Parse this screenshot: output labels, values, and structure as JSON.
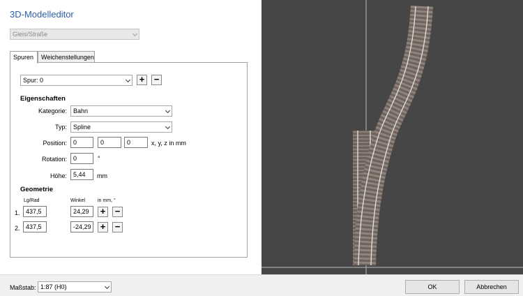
{
  "app_title": "3D-Modelleditor",
  "type_select": {
    "value": "Gleis/Straße"
  },
  "tabs": [
    {
      "label": "Spuren",
      "active": true
    },
    {
      "label": "Weichenstellungen",
      "active": false
    }
  ],
  "track_select": {
    "value": "Spur: 0"
  },
  "properties": {
    "heading": "Eigenschaften",
    "kategorie_label": "Kategorie:",
    "kategorie_value": "Bahn",
    "typ_label": "Typ:",
    "typ_value": "Spline",
    "position_label": "Position:",
    "position_x": "0",
    "position_y": "0",
    "position_z": "0",
    "position_unit": "x, y, z in mm",
    "rotation_label": "Rotation:",
    "rotation_value": "0",
    "rotation_unit": "°",
    "height_label": "Höhe:",
    "height_value": "5,44",
    "height_unit": "mm"
  },
  "geometry": {
    "heading": "Geometrie",
    "col_length": "Lg/Rad",
    "col_angle": "Winkel",
    "col_units": "in mm, °",
    "rows": [
      {
        "index": "1.",
        "length": "437,5",
        "angle": "24,29"
      },
      {
        "index": "2.",
        "length": "437,5",
        "angle": "-24,29"
      }
    ]
  },
  "icons": {
    "add": "+",
    "remove": "−"
  },
  "footer": {
    "scale_label": "Maßstab:",
    "scale_value": "1:87 (H0)",
    "ok_label": "OK",
    "cancel_label": "Abbrechen"
  },
  "colors": {
    "title": "#2b5ea8",
    "viewport_bg": "#464646",
    "rail": "#dcdcdc",
    "tie": "#6e625b"
  }
}
